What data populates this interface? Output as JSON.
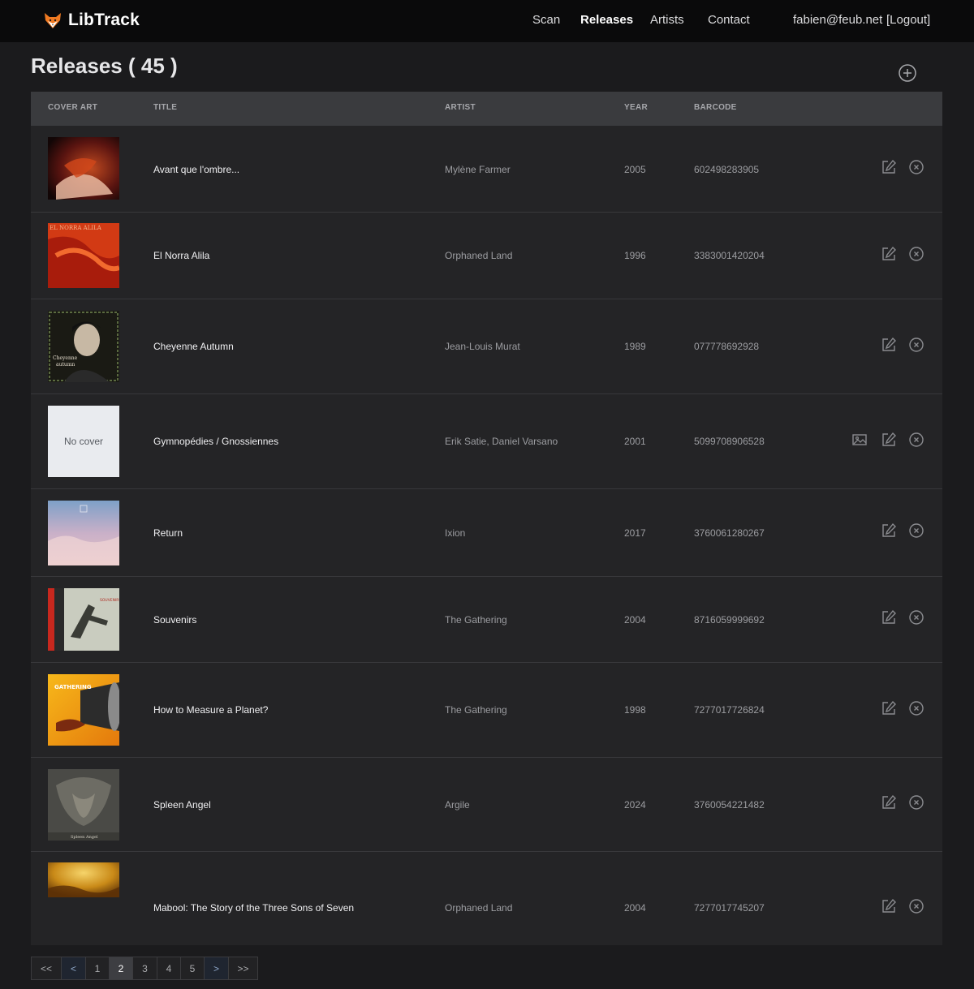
{
  "app": {
    "brand": "LibTrack"
  },
  "nav": {
    "links": [
      "Scan",
      "Releases",
      "Artists",
      "Contact"
    ],
    "active": "Releases",
    "user_email": "fabien@feub.net",
    "logout_label": "[Logout]"
  },
  "page": {
    "title": "Releases ( 45 )",
    "add_icon": "plus-circle-icon"
  },
  "table": {
    "columns": [
      "COVER ART",
      "TITLE",
      "ARTIST",
      "YEAR",
      "BARCODE"
    ],
    "rows": [
      {
        "title": "Avant que l'ombre...",
        "artist": "Mylène Farmer",
        "year": "2005",
        "barcode": "602498283905",
        "cover": "image"
      },
      {
        "title": "El Norra Alila",
        "artist": "Orphaned Land",
        "year": "1996",
        "barcode": "3383001420204",
        "cover": "image"
      },
      {
        "title": "Cheyenne Autumn",
        "artist": "Jean-Louis Murat",
        "year": "1989",
        "barcode": "077778692928",
        "cover": "image"
      },
      {
        "title": "Gymnopédies / Gnossiennes",
        "artist": "Erik Satie, Daniel Varsano",
        "year": "2001",
        "barcode": "5099708906528",
        "cover": "none",
        "no_cover_label": "No cover"
      },
      {
        "title": "Return",
        "artist": "Ixion",
        "year": "2017",
        "barcode": "3760061280267",
        "cover": "image"
      },
      {
        "title": "Souvenirs",
        "artist": "The Gathering",
        "year": "2004",
        "barcode": "8716059999692",
        "cover": "image"
      },
      {
        "title": "How to Measure a Planet?",
        "artist": "The Gathering",
        "year": "1998",
        "barcode": "7277017726824",
        "cover": "image"
      },
      {
        "title": "Spleen Angel",
        "artist": "Argile",
        "year": "2024",
        "barcode": "3760054221482",
        "cover": "image"
      },
      {
        "title": "Mabool: The Story of the Three Sons of Seven",
        "artist": "Orphaned Land",
        "year": "2004",
        "barcode": "7277017745207",
        "cover": "image"
      }
    ],
    "row_icons": [
      "edit-icon",
      "delete-icon"
    ],
    "extra_icon_no_cover": "image-icon"
  },
  "pagination": {
    "items": [
      "<<",
      "<",
      "1",
      "2",
      "3",
      "4",
      "5",
      ">",
      ">>"
    ],
    "current": "2"
  },
  "colors": {
    "background": "#1b1b1d",
    "navbar": "#0a0a0b",
    "table_header": "#3a3b3e",
    "table_body": "#242426"
  }
}
